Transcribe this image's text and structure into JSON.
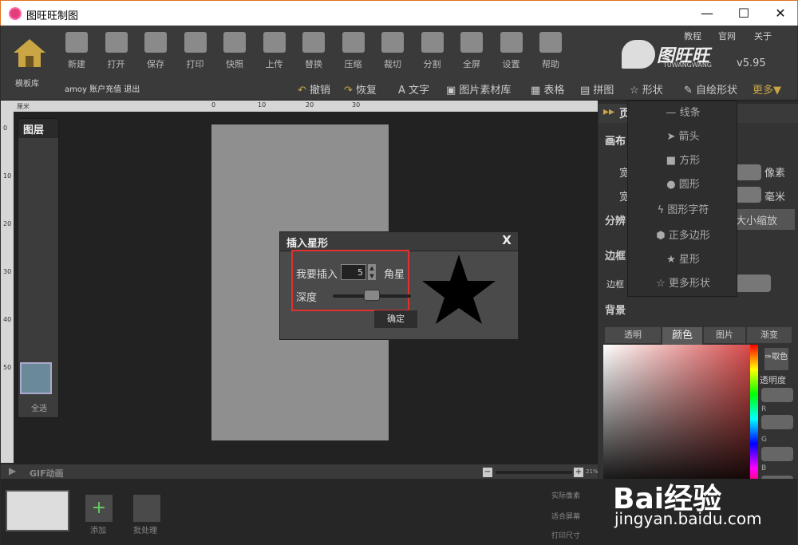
{
  "window": {
    "title": "图旺旺制图",
    "minimize": "—",
    "maximize": "☐",
    "close": "✕"
  },
  "header_links": [
    "教程",
    "官网",
    "关于"
  ],
  "brand": {
    "name": "图旺旺",
    "sub": "TUWANGWANG",
    "version": "v5.95"
  },
  "toolbar": {
    "template_lib": "模板库",
    "tools": [
      {
        "label": "新建",
        "icon": "new-file-icon"
      },
      {
        "label": "打开",
        "icon": "folder-open-icon"
      },
      {
        "label": "保存",
        "icon": "save-icon"
      },
      {
        "label": "打印",
        "icon": "printer-icon"
      },
      {
        "label": "快照",
        "icon": "camera-icon"
      },
      {
        "label": "上传",
        "icon": "upload-icon"
      },
      {
        "label": "替换",
        "icon": "replace-icon"
      },
      {
        "label": "压缩",
        "icon": "compress-icon"
      },
      {
        "label": "裁切",
        "icon": "scissors-icon"
      },
      {
        "label": "分割",
        "icon": "crop-icon"
      },
      {
        "label": "全屏",
        "icon": "monitor-icon"
      },
      {
        "label": "设置",
        "icon": "gear-icon"
      },
      {
        "label": "帮助",
        "icon": "help-icon"
      }
    ],
    "account": "amoy 账户充值 退出",
    "undo": "撤销",
    "redo": "恢复",
    "actions": [
      "文字",
      "图片素材库",
      "表格",
      "拼图",
      "形状",
      "自绘形状",
      "更多▼"
    ]
  },
  "ruler_unit": "厘米",
  "ruler_marks": [
    "0",
    "10",
    "20",
    "30"
  ],
  "vruler_marks": [
    "0",
    "10",
    "20",
    "30",
    "40",
    "50"
  ],
  "layers": {
    "title": "图层",
    "select_all": "全选"
  },
  "shape_menu": [
    "线条",
    "箭头",
    "方形",
    "圆形",
    "图形字符",
    "正多边形",
    "星形",
    "更多形状"
  ],
  "right_panel": {
    "header": "页",
    "canvas_label": "画布",
    "width_short": "宽",
    "height_short": "宽",
    "unit_px": "像素",
    "unit_mm": "毫米",
    "resolution": "分辨",
    "scale_btn": "大小缩放",
    "border": "边框",
    "border_sub": "边框",
    "background": "背景",
    "bg_tabs": [
      "透明",
      "颜色",
      "图片",
      "渐变"
    ],
    "pick": "取色",
    "opacity": "透明度",
    "channels": [
      "R",
      "G",
      "B"
    ]
  },
  "dialog": {
    "title": "插入星形",
    "close": "X",
    "prefix": "我要插入",
    "points_value": "5",
    "suffix": "角星",
    "depth_label": "深度",
    "depth_value": 0.4,
    "confirm": "确定"
  },
  "bottom": {
    "gif": "GIF动画",
    "zoom": "21%",
    "add": "添加",
    "batch": "批处理",
    "right_opts": [
      "实际像素",
      "适合屏幕",
      "打印尺寸"
    ]
  },
  "watermark": {
    "text": "Bai经验",
    "url": "jingyan.baidu.com"
  }
}
